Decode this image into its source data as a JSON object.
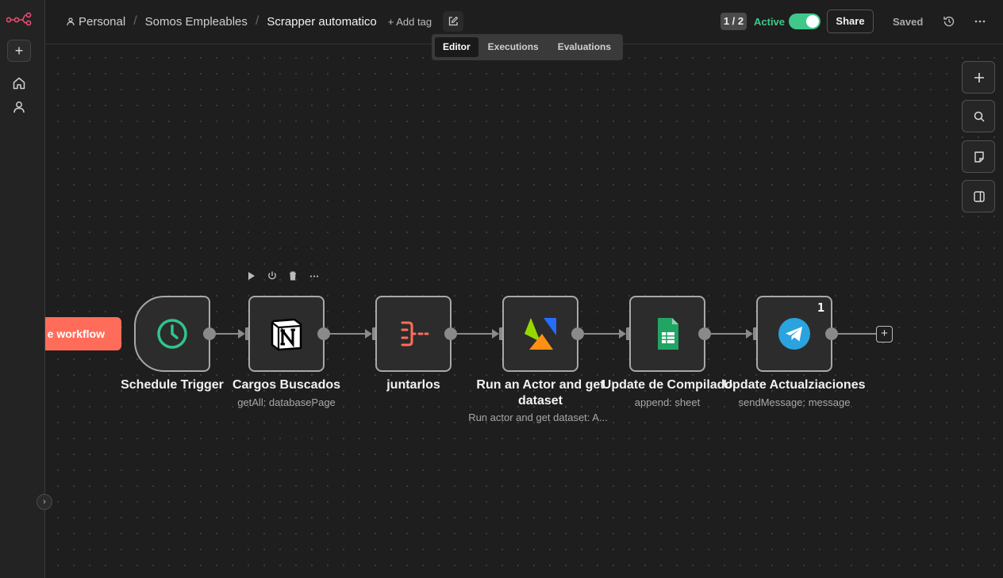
{
  "breadcrumb": {
    "owner": "Personal",
    "project": "Somos Empleables",
    "workflow": "Scrapper automatico",
    "add_tag": "+ Add tag"
  },
  "header": {
    "version_counter": "1 / 2",
    "active_label": "Active",
    "active": true,
    "share_label": "Share",
    "saved_label": "Saved"
  },
  "tabs": [
    {
      "label": "Editor",
      "active": true
    },
    {
      "label": "Executions",
      "active": false
    },
    {
      "label": "Evaluations",
      "active": false
    }
  ],
  "canvas": {
    "trigger_button": "e workflow",
    "nodes": [
      {
        "title": "Schedule Trigger",
        "subtitle": "",
        "icon": "clock-icon"
      },
      {
        "title": "Cargos Buscados",
        "subtitle": "getAll: databasePage",
        "icon": "notion-icon"
      },
      {
        "title": "juntarlos",
        "subtitle": "",
        "icon": "merge-icon"
      },
      {
        "title": "Run an Actor and get dataset",
        "subtitle": "Run actor and get dataset: A...",
        "icon": "apify-icon"
      },
      {
        "title": "Update de Compilado",
        "subtitle": "append: sheet",
        "icon": "google-sheets-icon"
      },
      {
        "title": "Update Actualziaciones",
        "subtitle": "sendMessage: message",
        "icon": "telegram-icon",
        "badge": "1"
      }
    ]
  },
  "colors": {
    "accent_active": "#3fc88a",
    "trigger_button": "#ff6d5a",
    "brand": "#ea4b71"
  }
}
